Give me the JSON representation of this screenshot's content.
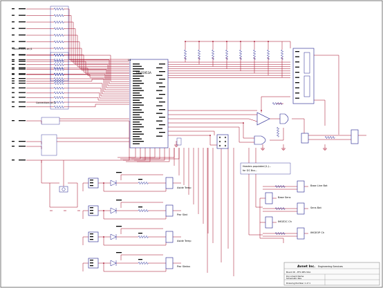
{
  "colors": {
    "wire": "#a0001e",
    "component": "#1a1a8c",
    "text": "#000000",
    "frame": "#555555",
    "title_block": "#8a8a8a"
  },
  "left_connector": {
    "group_top_label": "Connections on J1",
    "group_mid_label": "Connections on J2"
  },
  "ic_main": {
    "ref": "U1",
    "part": "TPS65953A"
  },
  "annotation": {
    "line1": "Headers populated J1-J...",
    "line2": "for I2C Bus..."
  },
  "sensor_labels": [
    "Base Line Bat",
    "Base Sens",
    "Sens Bat",
    "IMGE2C Ch",
    "IMGEOP Ch"
  ],
  "led_labels": [
    "Aside Temp",
    "Pwr Stat",
    "Aside Temp",
    "Pwr Status"
  ],
  "title_block": {
    "company": "Avnet Inc.",
    "dept": "Engineering Services",
    "field_label": "Document Name",
    "document": "Schematic Rev",
    "doc_number": "Board ID - EF1 REV 00A",
    "footer": "Drawing Number  1  of  1"
  }
}
